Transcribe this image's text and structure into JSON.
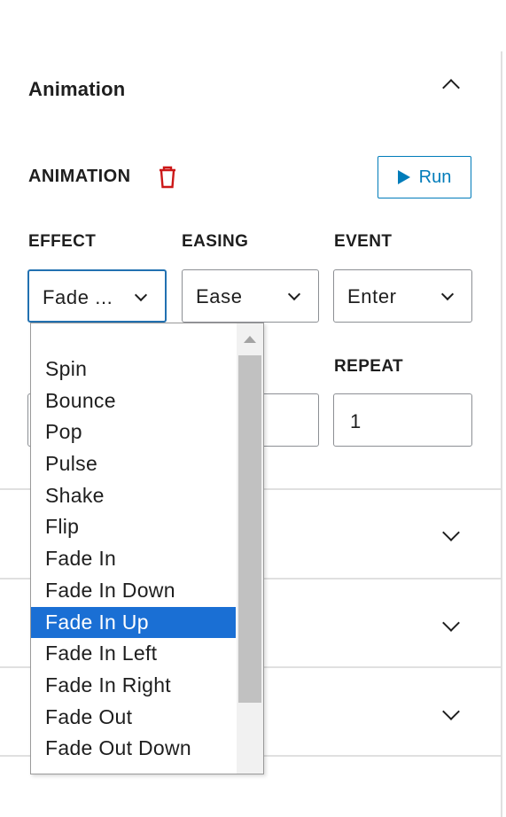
{
  "section": {
    "title": "Animation"
  },
  "animation": {
    "label": "ANIMATION",
    "run_label": "Run"
  },
  "fields": {
    "effect_label": "EFFECT",
    "easing_label": "EASING",
    "event_label": "EVENT",
    "repeat_label": "REPEAT",
    "effect_value": "Fade ...",
    "easing_value": "Ease",
    "event_value": "Enter",
    "repeat_value": "1"
  },
  "effect_dropdown": {
    "options": [
      "Spin",
      "Bounce",
      "Pop",
      "Pulse",
      "Shake",
      "Flip",
      "Fade In",
      "Fade In Down",
      "Fade In Up",
      "Fade In Left",
      "Fade In Right",
      "Fade Out",
      "Fade Out Down"
    ],
    "selected": "Fade In Up"
  },
  "colors": {
    "accent": "#007cba",
    "selected_bg": "#1a6fd4",
    "delete_red": "#cc1818"
  }
}
